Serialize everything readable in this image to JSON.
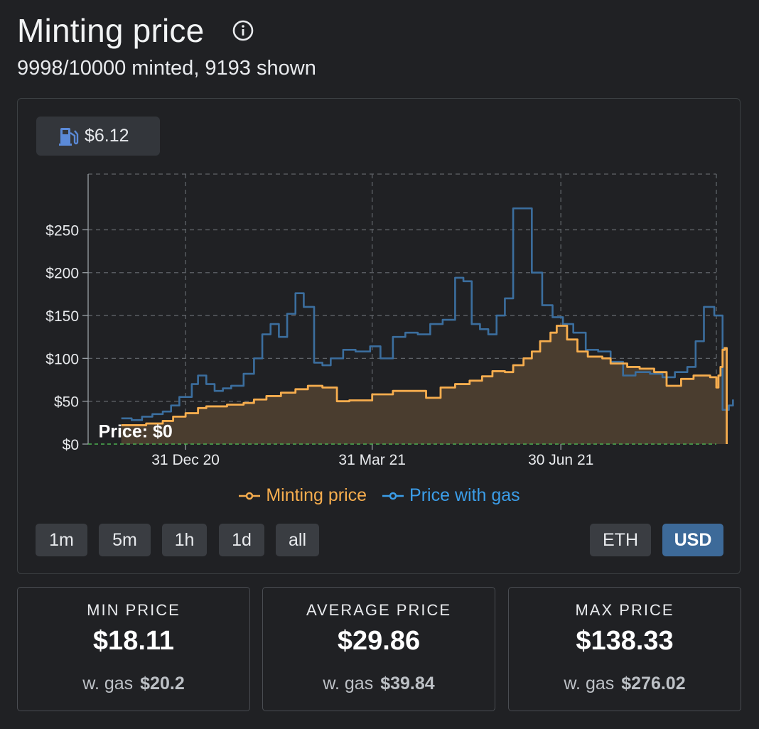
{
  "header": {
    "title": "Minting price",
    "subtitle": "9998/10000 minted, 9193 shown"
  },
  "gas_badge": {
    "value": "$6.12"
  },
  "legend": [
    {
      "label": "Minting price",
      "color": "#f6ad4e"
    },
    {
      "label": "Price with gas",
      "color": "#3b9de8"
    }
  ],
  "time_buttons": [
    "1m",
    "5m",
    "1h",
    "1d",
    "all"
  ],
  "currency_buttons": {
    "eth": "ETH",
    "usd": "USD",
    "active": "USD"
  },
  "stats": [
    {
      "label": "MIN PRICE",
      "value": "$18.11",
      "gas_label": "w. gas",
      "gas_value": "$20.2"
    },
    {
      "label": "AVERAGE PRICE",
      "value": "$29.86",
      "gas_label": "w. gas",
      "gas_value": "$39.84"
    },
    {
      "label": "MAX PRICE",
      "value": "$138.33",
      "gas_label": "w. gas",
      "gas_value": "$276.02"
    }
  ],
  "chart_data": {
    "type": "line",
    "x_type": "date",
    "xlim": [
      "2020-11-14",
      "2021-09-13"
    ],
    "ylim": [
      0,
      315
    ],
    "x_ticks": [
      {
        "date": "2020-12-31",
        "label": "31 Dec 20"
      },
      {
        "date": "2021-03-31",
        "label": "31 Mar 21"
      },
      {
        "date": "2021-06-30",
        "label": "30 Jun 21"
      }
    ],
    "y_ticks": [
      {
        "value": 0,
        "label": "$0"
      },
      {
        "value": 50,
        "label": "$50"
      },
      {
        "value": 100,
        "label": "$100"
      },
      {
        "value": 150,
        "label": "$150"
      },
      {
        "value": 200,
        "label": "$200"
      },
      {
        "value": 250,
        "label": "$250"
      }
    ],
    "grid": true,
    "annotation": {
      "text": "Price: $0",
      "x": "2020-11-19",
      "y": 8
    },
    "step": true,
    "series": [
      {
        "name": "Minting price",
        "color": "#f6ad4e",
        "fill": true,
        "points": [
          [
            "2020-11-30",
            22
          ],
          [
            "2020-12-12",
            24
          ],
          [
            "2020-12-20",
            27
          ],
          [
            "2020-12-25",
            32
          ],
          [
            "2020-12-31",
            36
          ],
          [
            "2021-01-06",
            42
          ],
          [
            "2021-01-10",
            44
          ],
          [
            "2021-01-20",
            46
          ],
          [
            "2021-01-28",
            48
          ],
          [
            "2021-02-02",
            52
          ],
          [
            "2021-02-08",
            56
          ],
          [
            "2021-02-15",
            60
          ],
          [
            "2021-02-22",
            64
          ],
          [
            "2021-02-28",
            68
          ],
          [
            "2021-03-07",
            66
          ],
          [
            "2021-03-14",
            50
          ],
          [
            "2021-03-20",
            51
          ],
          [
            "2021-03-31",
            58
          ],
          [
            "2021-04-10",
            62
          ],
          [
            "2021-04-20",
            62
          ],
          [
            "2021-04-26",
            54
          ],
          [
            "2021-05-03",
            66
          ],
          [
            "2021-05-10",
            70
          ],
          [
            "2021-05-17",
            74
          ],
          [
            "2021-05-23",
            79
          ],
          [
            "2021-05-28",
            85
          ],
          [
            "2021-06-03",
            84
          ],
          [
            "2021-06-07",
            92
          ],
          [
            "2021-06-12",
            100
          ],
          [
            "2021-06-16",
            108
          ],
          [
            "2021-06-20",
            120
          ],
          [
            "2021-06-25",
            130
          ],
          [
            "2021-06-28",
            138
          ],
          [
            "2021-07-03",
            122
          ],
          [
            "2021-07-08",
            108
          ],
          [
            "2021-07-13",
            102
          ],
          [
            "2021-07-20",
            100
          ],
          [
            "2021-07-24",
            94
          ],
          [
            "2021-08-01",
            90
          ],
          [
            "2021-08-07",
            88
          ],
          [
            "2021-08-14",
            84
          ],
          [
            "2021-08-20",
            68
          ],
          [
            "2021-08-27",
            76
          ],
          [
            "2021-09-02",
            80
          ],
          [
            "2021-09-07",
            80
          ],
          [
            "2021-09-10",
            78
          ],
          [
            "2021-09-13",
            66
          ],
          [
            "2021-09-14",
            80
          ],
          [
            "2021-09-15",
            90
          ],
          [
            "2021-09-16",
            110
          ],
          [
            "2021-09-17",
            112
          ],
          [
            "2021-09-18",
            0
          ]
        ]
      },
      {
        "name": "Price with gas",
        "color": "#3b6e9e",
        "fill": false,
        "points": [
          [
            "2020-11-30",
            30
          ],
          [
            "2020-12-05",
            28
          ],
          [
            "2020-12-10",
            32
          ],
          [
            "2020-12-15",
            35
          ],
          [
            "2020-12-20",
            38
          ],
          [
            "2020-12-24",
            45
          ],
          [
            "2020-12-28",
            55
          ],
          [
            "2020-12-31",
            55
          ],
          [
            "2021-01-03",
            70
          ],
          [
            "2021-01-06",
            80
          ],
          [
            "2021-01-10",
            70
          ],
          [
            "2021-01-14",
            62
          ],
          [
            "2021-01-18",
            65
          ],
          [
            "2021-01-22",
            68
          ],
          [
            "2021-01-28",
            82
          ],
          [
            "2021-02-02",
            100
          ],
          [
            "2021-02-06",
            128
          ],
          [
            "2021-02-10",
            140
          ],
          [
            "2021-02-14",
            125
          ],
          [
            "2021-02-18",
            152
          ],
          [
            "2021-02-22",
            176
          ],
          [
            "2021-02-26",
            160
          ],
          [
            "2021-03-03",
            95
          ],
          [
            "2021-03-07",
            92
          ],
          [
            "2021-03-11",
            100
          ],
          [
            "2021-03-17",
            110
          ],
          [
            "2021-03-23",
            108
          ],
          [
            "2021-03-30",
            114
          ],
          [
            "2021-04-04",
            100
          ],
          [
            "2021-04-10",
            125
          ],
          [
            "2021-04-16",
            130
          ],
          [
            "2021-04-22",
            128
          ],
          [
            "2021-04-28",
            140
          ],
          [
            "2021-05-04",
            145
          ],
          [
            "2021-05-10",
            194
          ],
          [
            "2021-05-14",
            190
          ],
          [
            "2021-05-18",
            140
          ],
          [
            "2021-05-22",
            134
          ],
          [
            "2021-05-26",
            128
          ],
          [
            "2021-05-30",
            150
          ],
          [
            "2021-06-03",
            170
          ],
          [
            "2021-06-07",
            275
          ],
          [
            "2021-06-12",
            275
          ],
          [
            "2021-06-16",
            200
          ],
          [
            "2021-06-21",
            162
          ],
          [
            "2021-06-26",
            148
          ],
          [
            "2021-07-01",
            140
          ],
          [
            "2021-07-06",
            130
          ],
          [
            "2021-07-12",
            110
          ],
          [
            "2021-07-18",
            108
          ],
          [
            "2021-07-24",
            96
          ],
          [
            "2021-07-30",
            80
          ],
          [
            "2021-08-05",
            84
          ],
          [
            "2021-08-12",
            82
          ],
          [
            "2021-08-18",
            78
          ],
          [
            "2021-08-24",
            84
          ],
          [
            "2021-08-30",
            90
          ],
          [
            "2021-09-03",
            120
          ],
          [
            "2021-09-07",
            160
          ],
          [
            "2021-09-12",
            150
          ],
          [
            "2021-09-16",
            40
          ],
          [
            "2021-09-19",
            45
          ],
          [
            "2021-09-21",
            52
          ]
        ]
      }
    ]
  }
}
